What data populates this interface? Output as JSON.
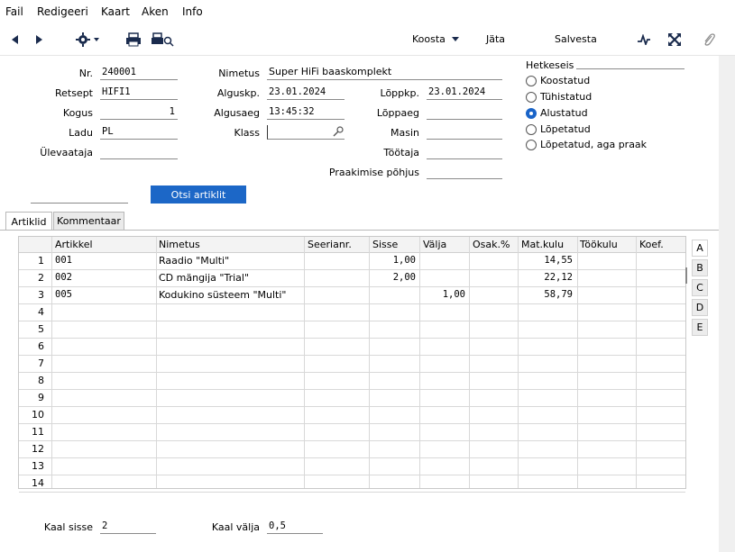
{
  "menu": [
    "Fail",
    "Redigeeri",
    "Kaart",
    "Aken",
    "Info"
  ],
  "toolbar": {
    "koosta": "Koosta",
    "jata": "Jäta",
    "salvesta": "Salvesta"
  },
  "form": {
    "nr_label": "Nr.",
    "nr_value": "240001",
    "retsept_label": "Retsept",
    "retsept_value": "HIFI1",
    "kogus_label": "Kogus",
    "kogus_value": "1",
    "ladu_label": "Ladu",
    "ladu_value": "PL",
    "ulevaataja_label": "Ülevaataja",
    "ulevaataja_value": "",
    "nimetus_label": "Nimetus",
    "nimetus_value": "Super HiFi baaskomplekt",
    "alguskp_label": "Alguskp.",
    "alguskp_value": "23.01.2024",
    "algusaeg_label": "Algusaeg",
    "algusaeg_value": "13:45:32",
    "klass_label": "Klass",
    "klass_value": "",
    "loppkp_label": "Lõppkp.",
    "loppkp_value": "23.01.2024",
    "loppaeg_label": "Lõppaeg",
    "loppaeg_value": "",
    "masin_label": "Masin",
    "masin_value": "",
    "tootaja_label": "Töötaja",
    "tootaja_value": "",
    "praakimise_label": "Praakimise põhjus",
    "praakimise_value": "",
    "left_blank_value": ""
  },
  "status": {
    "label": "Hetkeseis",
    "options": [
      "Koostatud",
      "Tühistatud",
      "Alustatud",
      "Lõpetatud",
      "Lõpetatud, aga praak"
    ],
    "selected": "Alustatud"
  },
  "otsi_button": "Otsi artiklit",
  "tabs": [
    "Artiklid",
    "Kommentaar"
  ],
  "grid": {
    "columns": [
      "Artikkel",
      "Nimetus",
      "Seerianr.",
      "Sisse",
      "Välja",
      "Osak.%",
      "Mat.kulu",
      "Töökulu",
      "Koef."
    ],
    "row_numbers": [
      "1",
      "2",
      "3",
      "4",
      "5",
      "6",
      "7",
      "8",
      "9",
      "10",
      "11",
      "12",
      "13",
      "14"
    ],
    "rows": [
      {
        "artikkel": "001",
        "nimetus": "Raadio \"Multi\"",
        "sisse": "1,00",
        "valja": "",
        "matkulu": "14,55"
      },
      {
        "artikkel": "002",
        "nimetus": "CD mängija \"Trial\"",
        "sisse": "2,00",
        "valja": "",
        "matkulu": "22,12"
      },
      {
        "artikkel": "005",
        "nimetus": "Kodukino süsteem \"Multi\"",
        "sisse": "",
        "valja": "1,00",
        "matkulu": "58,79"
      }
    ]
  },
  "side_tabs": [
    "A",
    "B",
    "C",
    "D",
    "E"
  ],
  "footer": {
    "kaal_sisse_label": "Kaal sisse",
    "kaal_sisse_value": "2",
    "kaal_valja_label": "Kaal välja",
    "kaal_valja_value": "0,5"
  }
}
